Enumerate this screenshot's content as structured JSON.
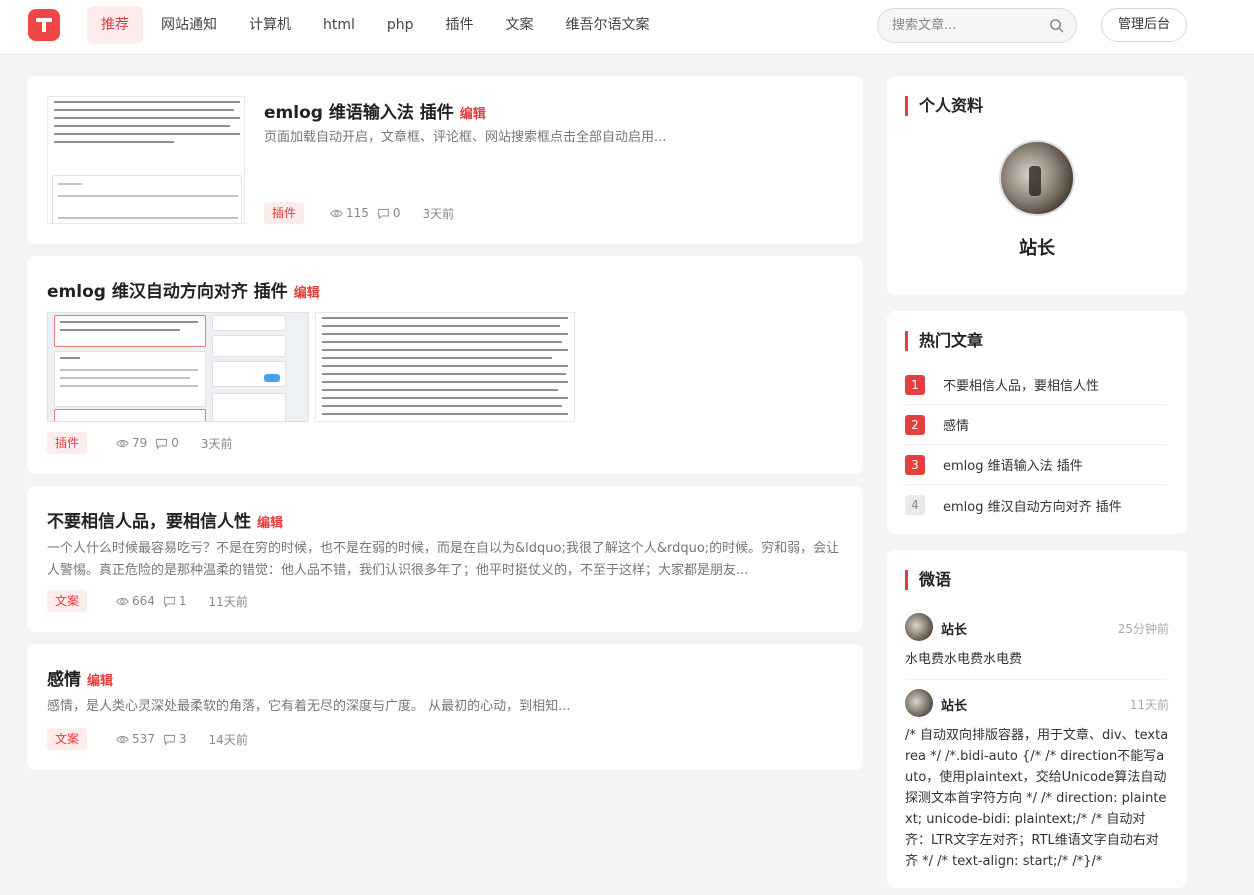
{
  "nav": {
    "items": [
      "推荐",
      "网站通知",
      "计算机",
      "html",
      "php",
      "插件",
      "文案",
      "维吾尔语文案"
    ],
    "active": 0
  },
  "search": {
    "placeholder": "搜索文章..."
  },
  "admin_label": "管理后台",
  "edit_label": "编辑",
  "posts": [
    {
      "title": "emlog 维语输入法 插件",
      "excerpt": "页面加载自动开启，文章框、评论框、网站搜索框点击全部自动启用...",
      "tag": "插件",
      "views": "115",
      "comments": "0",
      "time": "3天前"
    },
    {
      "title": "emlog 维汉自动方向对齐 插件",
      "excerpt": "",
      "tag": "插件",
      "views": "79",
      "comments": "0",
      "time": "3天前"
    },
    {
      "title": "不要相信人品，要相信人性",
      "excerpt": "一个人什么时候最容易吃亏？不是在穷的时候，也不是在弱的时候，而是在自以为&ldquo;我很了解这个人&rdquo;的时候。穷和弱，会让人警惕。真正危险的是那种温柔的错觉：他人品不错，我们认识很多年了；他平时挺仗义的，不至于这样；大家都是朋友...",
      "tag": "文案",
      "views": "664",
      "comments": "1",
      "time": "11天前"
    },
    {
      "title": "感情",
      "excerpt": "感情，是人类心灵深处最柔软的角落，它有着无尽的深度与广度。 从最初的心动，到相知...",
      "tag": "文案",
      "views": "537",
      "comments": "3",
      "time": "14天前"
    }
  ],
  "profile": {
    "title": "个人资料",
    "name": "站长"
  },
  "hot": {
    "title": "热门文章",
    "items": [
      {
        "rank": "1",
        "label": "不要相信人品，要相信人性"
      },
      {
        "rank": "2",
        "label": "感情"
      },
      {
        "rank": "3",
        "label": "emlog 维语输入法 插件"
      },
      {
        "rank": "4",
        "label": "emlog 维汉自动方向对齐 插件"
      }
    ]
  },
  "twitter": {
    "title": "微语",
    "items": [
      {
        "name": "站长",
        "time": "25分钟前",
        "text": "水电费水电费水电费"
      },
      {
        "name": "站长",
        "time": "11天前",
        "text": "/* 自动双向排版容器，用于文章、div、textarea */ /*.bidi-auto {/* /* direction不能写auto，使用plaintext，交给Unicode算法自动探测文本首字符方向 */ /* direction: plaintext; unicode-bidi: plaintext;/* /* 自动对齐：LTR文字左对齐；RTL维语文字自动右对齐 */ /* text-align: start;/* /*}/*"
      }
    ]
  },
  "colors": {
    "accent": "#e53e3e",
    "tag_bg": "#fdecec",
    "page_bg": "#f3f4f6"
  }
}
